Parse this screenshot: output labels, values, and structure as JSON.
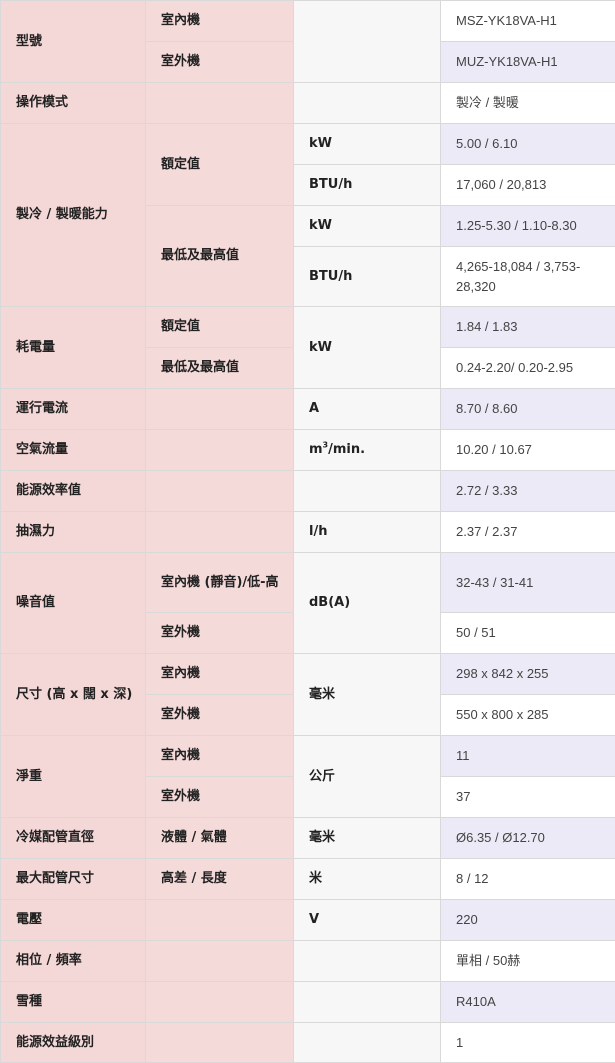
{
  "colors": {
    "label_col": "#f4d7d7",
    "sub_col": "#f5dada",
    "unit_col": "#f7f7f7",
    "value_alt": "#eceaf6",
    "border": "#d9d9d9"
  },
  "rows": {
    "model": {
      "label": "型號",
      "indoor": "室內機",
      "outdoor": "室外機",
      "indoor_value": "MSZ-YK18VA-H1",
      "outdoor_value": "MUZ-YK18VA-H1"
    },
    "mode": {
      "label": "操作模式",
      "value": "製冷 / 製暖"
    },
    "capacity": {
      "label": "製冷 / 製暖能力",
      "rated": "額定值",
      "minmax": "最低及最高值",
      "unit_kw": "kW",
      "unit_btu": "BTU/h",
      "rated_kw": "5.00 / 6.10",
      "rated_btu": "17,060 / 20,813",
      "minmax_kw": "1.25-5.30 / 1.10-8.30",
      "minmax_btu": "4,265-18,084 / 3,753-28,320"
    },
    "power": {
      "label": "耗電量",
      "rated": "額定值",
      "minmax": "最低及最高值",
      "unit": "kW",
      "rated_value": "1.84 / 1.83",
      "minmax_value": "0.24-2.20/ 0.20-2.95"
    },
    "current": {
      "label": "運行電流",
      "unit": "A",
      "value": "8.70 / 8.60"
    },
    "airflow": {
      "label": "空氣流量",
      "unit_base": "m",
      "unit_sup": "3",
      "unit_tail": "/min.",
      "value": "10.20 / 10.67"
    },
    "efficiency": {
      "label": "能源效率值",
      "value": "2.72 / 3.33"
    },
    "dehumid": {
      "label": "抽濕力",
      "unit": "l/h",
      "value": "2.37 / 2.37"
    },
    "noise": {
      "label": "噪音值",
      "indoor": "室內機 (靜音)/低-高",
      "outdoor": "室外機",
      "unit": "dB(A)",
      "indoor_value": "32-43 / 31-41",
      "outdoor_value": "50 / 51"
    },
    "dimension": {
      "label": "尺寸 (高 x 闊 x 深)",
      "indoor": "室內機",
      "outdoor": "室外機",
      "unit": "毫米",
      "indoor_value": "298 x 842 x 255",
      "outdoor_value": "550 x 800 x 285"
    },
    "weight": {
      "label": "淨重",
      "indoor": "室內機",
      "outdoor": "室外機",
      "unit": "公斤",
      "indoor_value": "11",
      "outdoor_value": "37"
    },
    "pipe_dia": {
      "label": "冷媒配管直徑",
      "sub": "液體 / 氣體",
      "unit": "毫米",
      "value": "Ø6.35 / Ø12.70"
    },
    "pipe_len": {
      "label": "最大配管尺寸",
      "sub": "高差 / 長度",
      "unit": "米",
      "value": "8 / 12"
    },
    "voltage": {
      "label": "電壓",
      "unit": "V",
      "value": "220"
    },
    "phase": {
      "label": "相位 / 頻率",
      "value": "單相 / 50赫"
    },
    "refrigerant": {
      "label": "雪種",
      "value": "R410A"
    },
    "grade": {
      "label": "能源效益級別",
      "value": "1"
    }
  }
}
